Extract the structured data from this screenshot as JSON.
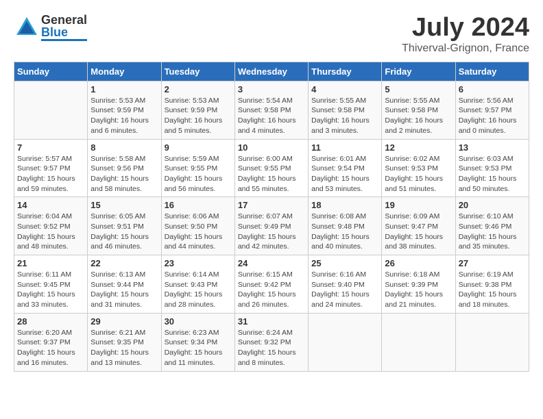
{
  "header": {
    "logo_general": "General",
    "logo_blue": "Blue",
    "title": "July 2024",
    "subtitle": "Thiverval-Grignon, France"
  },
  "days_of_week": [
    "Sunday",
    "Monday",
    "Tuesday",
    "Wednesday",
    "Thursday",
    "Friday",
    "Saturday"
  ],
  "weeks": [
    [
      {
        "day": "",
        "info": ""
      },
      {
        "day": "1",
        "info": "Sunrise: 5:53 AM\nSunset: 9:59 PM\nDaylight: 16 hours\nand 6 minutes."
      },
      {
        "day": "2",
        "info": "Sunrise: 5:53 AM\nSunset: 9:59 PM\nDaylight: 16 hours\nand 5 minutes."
      },
      {
        "day": "3",
        "info": "Sunrise: 5:54 AM\nSunset: 9:58 PM\nDaylight: 16 hours\nand 4 minutes."
      },
      {
        "day": "4",
        "info": "Sunrise: 5:55 AM\nSunset: 9:58 PM\nDaylight: 16 hours\nand 3 minutes."
      },
      {
        "day": "5",
        "info": "Sunrise: 5:55 AM\nSunset: 9:58 PM\nDaylight: 16 hours\nand 2 minutes."
      },
      {
        "day": "6",
        "info": "Sunrise: 5:56 AM\nSunset: 9:57 PM\nDaylight: 16 hours\nand 0 minutes."
      }
    ],
    [
      {
        "day": "7",
        "info": "Sunrise: 5:57 AM\nSunset: 9:57 PM\nDaylight: 15 hours\nand 59 minutes."
      },
      {
        "day": "8",
        "info": "Sunrise: 5:58 AM\nSunset: 9:56 PM\nDaylight: 15 hours\nand 58 minutes."
      },
      {
        "day": "9",
        "info": "Sunrise: 5:59 AM\nSunset: 9:55 PM\nDaylight: 15 hours\nand 56 minutes."
      },
      {
        "day": "10",
        "info": "Sunrise: 6:00 AM\nSunset: 9:55 PM\nDaylight: 15 hours\nand 55 minutes."
      },
      {
        "day": "11",
        "info": "Sunrise: 6:01 AM\nSunset: 9:54 PM\nDaylight: 15 hours\nand 53 minutes."
      },
      {
        "day": "12",
        "info": "Sunrise: 6:02 AM\nSunset: 9:53 PM\nDaylight: 15 hours\nand 51 minutes."
      },
      {
        "day": "13",
        "info": "Sunrise: 6:03 AM\nSunset: 9:53 PM\nDaylight: 15 hours\nand 50 minutes."
      }
    ],
    [
      {
        "day": "14",
        "info": "Sunrise: 6:04 AM\nSunset: 9:52 PM\nDaylight: 15 hours\nand 48 minutes."
      },
      {
        "day": "15",
        "info": "Sunrise: 6:05 AM\nSunset: 9:51 PM\nDaylight: 15 hours\nand 46 minutes."
      },
      {
        "day": "16",
        "info": "Sunrise: 6:06 AM\nSunset: 9:50 PM\nDaylight: 15 hours\nand 44 minutes."
      },
      {
        "day": "17",
        "info": "Sunrise: 6:07 AM\nSunset: 9:49 PM\nDaylight: 15 hours\nand 42 minutes."
      },
      {
        "day": "18",
        "info": "Sunrise: 6:08 AM\nSunset: 9:48 PM\nDaylight: 15 hours\nand 40 minutes."
      },
      {
        "day": "19",
        "info": "Sunrise: 6:09 AM\nSunset: 9:47 PM\nDaylight: 15 hours\nand 38 minutes."
      },
      {
        "day": "20",
        "info": "Sunrise: 6:10 AM\nSunset: 9:46 PM\nDaylight: 15 hours\nand 35 minutes."
      }
    ],
    [
      {
        "day": "21",
        "info": "Sunrise: 6:11 AM\nSunset: 9:45 PM\nDaylight: 15 hours\nand 33 minutes."
      },
      {
        "day": "22",
        "info": "Sunrise: 6:13 AM\nSunset: 9:44 PM\nDaylight: 15 hours\nand 31 minutes."
      },
      {
        "day": "23",
        "info": "Sunrise: 6:14 AM\nSunset: 9:43 PM\nDaylight: 15 hours\nand 28 minutes."
      },
      {
        "day": "24",
        "info": "Sunrise: 6:15 AM\nSunset: 9:42 PM\nDaylight: 15 hours\nand 26 minutes."
      },
      {
        "day": "25",
        "info": "Sunrise: 6:16 AM\nSunset: 9:40 PM\nDaylight: 15 hours\nand 24 minutes."
      },
      {
        "day": "26",
        "info": "Sunrise: 6:18 AM\nSunset: 9:39 PM\nDaylight: 15 hours\nand 21 minutes."
      },
      {
        "day": "27",
        "info": "Sunrise: 6:19 AM\nSunset: 9:38 PM\nDaylight: 15 hours\nand 18 minutes."
      }
    ],
    [
      {
        "day": "28",
        "info": "Sunrise: 6:20 AM\nSunset: 9:37 PM\nDaylight: 15 hours\nand 16 minutes."
      },
      {
        "day": "29",
        "info": "Sunrise: 6:21 AM\nSunset: 9:35 PM\nDaylight: 15 hours\nand 13 minutes."
      },
      {
        "day": "30",
        "info": "Sunrise: 6:23 AM\nSunset: 9:34 PM\nDaylight: 15 hours\nand 11 minutes."
      },
      {
        "day": "31",
        "info": "Sunrise: 6:24 AM\nSunset: 9:32 PM\nDaylight: 15 hours\nand 8 minutes."
      },
      {
        "day": "",
        "info": ""
      },
      {
        "day": "",
        "info": ""
      },
      {
        "day": "",
        "info": ""
      }
    ]
  ]
}
